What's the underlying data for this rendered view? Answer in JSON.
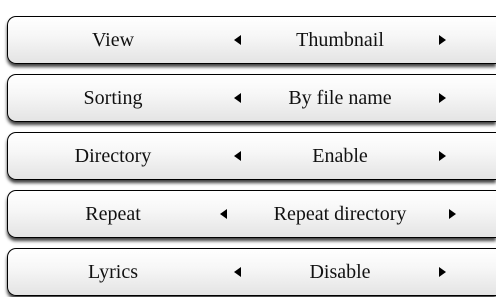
{
  "settings": {
    "rows": [
      {
        "label": "View",
        "value": "Thumbnail"
      },
      {
        "label": "Sorting",
        "value": "By file name"
      },
      {
        "label": "Directory",
        "value": "Enable"
      },
      {
        "label": "Repeat",
        "value": "Repeat directory"
      },
      {
        "label": "Lyrics",
        "value": "Disable"
      }
    ]
  },
  "icons": {
    "prev": "triangle-left-icon",
    "next": "triangle-right-icon"
  },
  "colors": {
    "row_border": "#000000",
    "row_gradient_top": "#ffffff",
    "row_gradient_bottom": "#e4e4e4",
    "text": "#111111"
  }
}
